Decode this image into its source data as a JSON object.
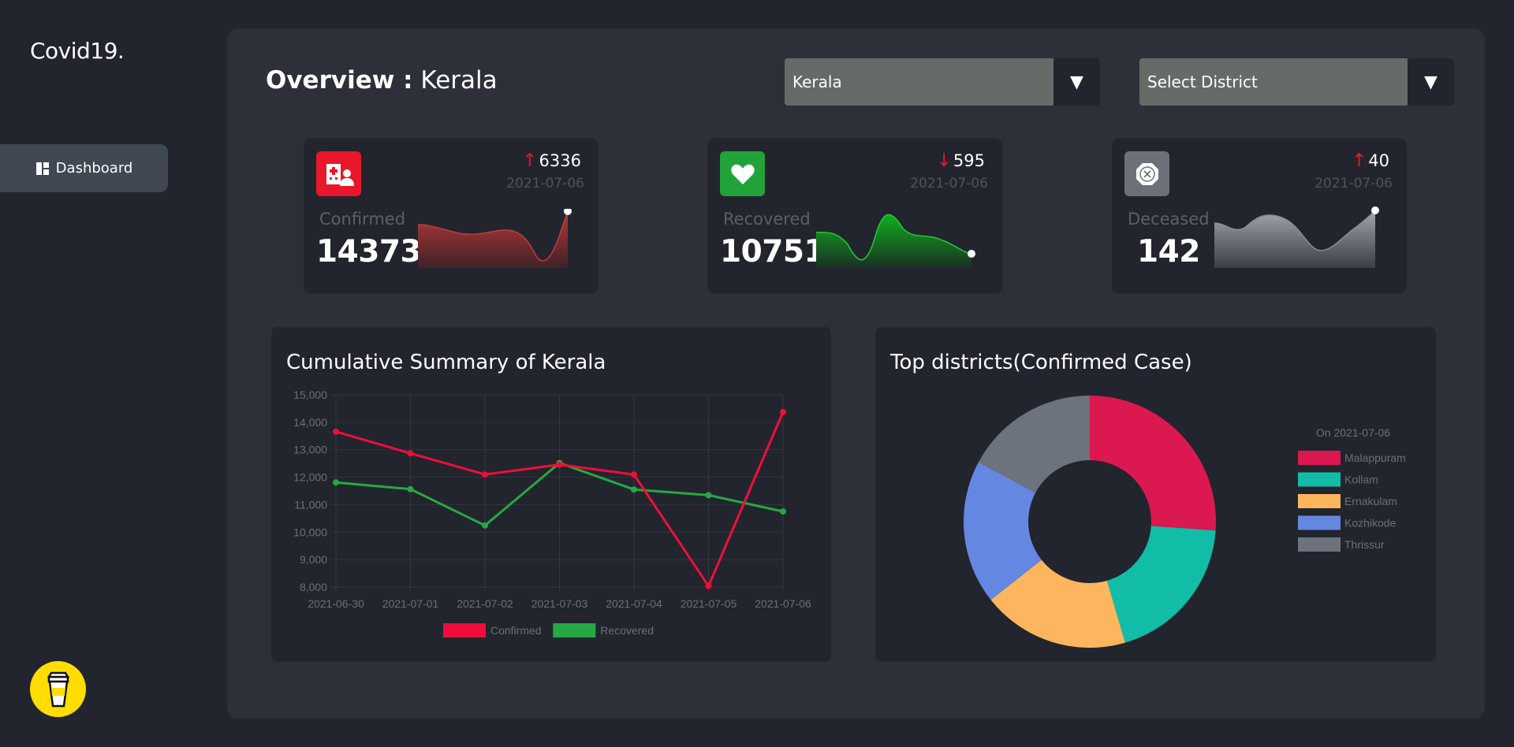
{
  "sidebar": {
    "logo": "Covid19.",
    "items": [
      {
        "label": "Dashboard",
        "icon": "dashboard-icon"
      }
    ],
    "footer_icon": "coffee-cup-icon"
  },
  "header": {
    "title_bold": "Overview :",
    "title_state": "Kerala",
    "state_select": {
      "value": "Kerala"
    },
    "district_select": {
      "placeholder": "Select District"
    }
  },
  "cards": [
    {
      "label": "Confirmed",
      "value": "14373",
      "delta": "6336",
      "delta_dir": "up",
      "date": "2021-07-06",
      "icon": "hospital-patient-icon",
      "color": "#e8172c"
    },
    {
      "label": "Recovered",
      "value": "10751",
      "delta": "595",
      "delta_dir": "down",
      "date": "2021-07-06",
      "icon": "heart-icon",
      "color": "#21a33a"
    },
    {
      "label": "Deceased",
      "value": "142",
      "delta": "40",
      "delta_dir": "up",
      "date": "2021-07-06",
      "icon": "close-octagon-icon",
      "color": "#6c7079"
    }
  ],
  "chart_data": [
    {
      "type": "line",
      "title": "Cumulative Summary of Kerala",
      "x": [
        "2021-06-30",
        "2021-07-01",
        "2021-07-02",
        "2021-07-03",
        "2021-07-04",
        "2021-07-05",
        "2021-07-06"
      ],
      "series": [
        {
          "name": "Confirmed",
          "color": "#ef0e3b",
          "values": [
            13658,
            12868,
            12100,
            12456,
            12095,
            8037,
            14373
          ]
        },
        {
          "name": "Recovered",
          "color": "#26a843",
          "values": [
            11808,
            11564,
            10243,
            12516,
            11551,
            11346,
            10751
          ]
        }
      ],
      "ylim": [
        8000,
        15000
      ],
      "yticks": [
        "15,000",
        "14,000",
        "13,000",
        "12,000",
        "11,000",
        "10,000",
        "9,000",
        "8,000"
      ],
      "grid": true,
      "legend": "bottom"
    },
    {
      "type": "pie",
      "title": "Top districts(Confirmed Case)",
      "subtitle": "On 2021-07-06",
      "categories": [
        "Malappuram",
        "Kollam",
        "Ernakulam",
        "Kozhikode",
        "Thrissur"
      ],
      "values": [
        2050,
        1520,
        1480,
        1450,
        1350
      ],
      "colors": [
        "#dc1851",
        "#12bda7",
        "#fdb65e",
        "#6488e2",
        "#6c737d"
      ],
      "legend": "right"
    }
  ]
}
